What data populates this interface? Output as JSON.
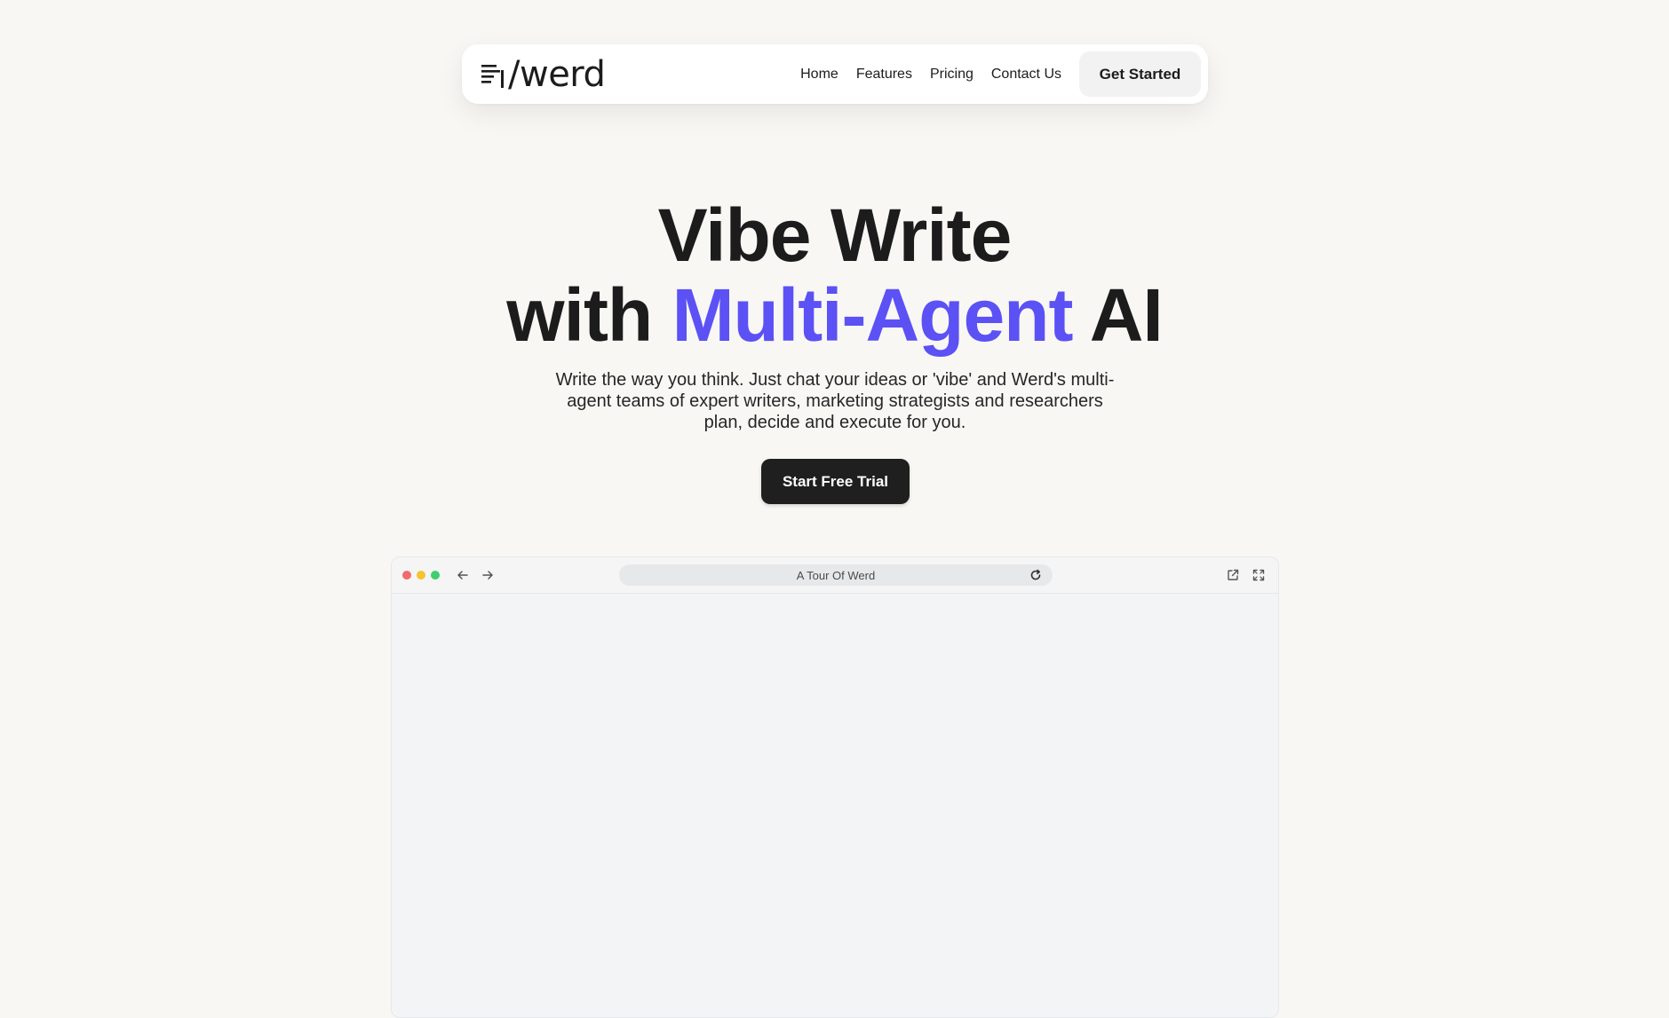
{
  "nav": {
    "logo_text": "/werd",
    "links": [
      "Home",
      "Features",
      "Pricing",
      "Contact Us"
    ],
    "cta_label": "Get Started"
  },
  "hero": {
    "line1": "Vibe Write",
    "line2_prefix": "with ",
    "line2_accent": "Multi-Agent",
    "line2_suffix": " AI",
    "subtitle": "Write the way you think. Just chat your ideas or 'vibe' and Werd's multi-agent teams of expert writers, marketing strategists and researchers plan, decide and execute for you.",
    "cta_label": "Start Free Trial"
  },
  "browser": {
    "url_title": "A Tour Of Werd",
    "icons": [
      "arrow-left-icon",
      "arrow-right-icon",
      "reload-icon",
      "external-link-icon",
      "expand-icon"
    ]
  },
  "colors": {
    "accent": "#5b51f5",
    "page_background": "#f8f7f4",
    "primary_button": "#1f1f1f",
    "traffic_red": "#f26a6a",
    "traffic_yellow": "#f5c430",
    "traffic_green": "#3ecf6e"
  }
}
